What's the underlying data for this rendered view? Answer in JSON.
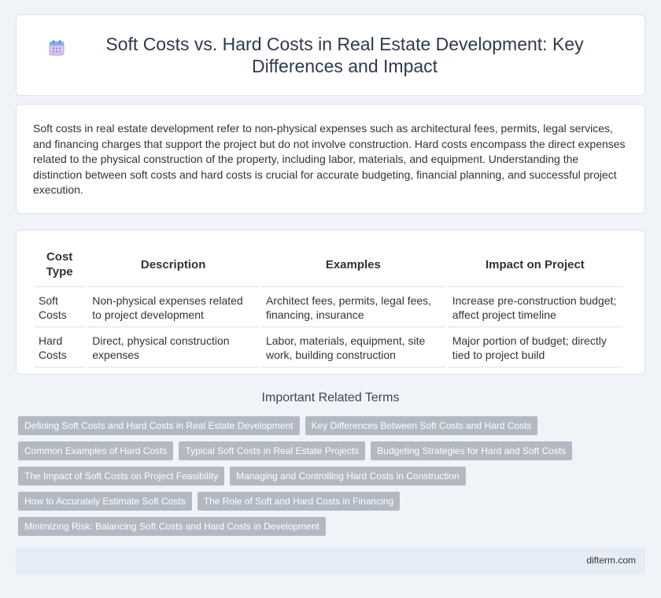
{
  "header": {
    "title": "Soft Costs vs. Hard Costs in Real Estate Development: Key Differences and Impact",
    "icon": "calendar-icon"
  },
  "intro": {
    "text": "Soft costs in real estate development refer to non-physical expenses such as architectural fees, permits, legal services, and financing charges that support the project but do not involve construction. Hard costs encompass the direct expenses related to the physical construction of the property, including labor, materials, and equipment. Understanding the distinction between soft costs and hard costs is crucial for accurate budgeting, financial planning, and successful project execution."
  },
  "table": {
    "headers": [
      "Cost Type",
      "Description",
      "Examples",
      "Impact on Project"
    ],
    "rows": [
      [
        "Soft Costs",
        "Non-physical expenses related to project development",
        "Architect fees, permits, legal fees, financing, insurance",
        "Increase pre-construction budget; affect project timeline"
      ],
      [
        "Hard Costs",
        "Direct, physical construction expenses",
        "Labor, materials, equipment, site work, building construction",
        "Major portion of budget; directly tied to project build"
      ]
    ]
  },
  "terms": {
    "title": "Important Related Terms",
    "items": [
      "Defining Soft Costs and Hard Costs in Real Estate Development",
      "Key Differences Between Soft Costs and Hard Costs",
      "Common Examples of Hard Costs",
      "Typical Soft Costs in Real Estate Projects",
      "Budgeting Strategies for Hard and Soft Costs",
      "The Impact of Soft Costs on Project Feasibility",
      "Managing and Controlling Hard Costs in Construction",
      "How to Accurately Estimate Soft Costs",
      "The Role of Soft and Hard Costs in Financing",
      "Minimizing Risk: Balancing Soft Costs and Hard Costs in Development"
    ]
  },
  "footer": {
    "site": "difterm.com"
  },
  "colors": {
    "background": "#f0f3f8",
    "tag": "#b3b9c3",
    "footer": "#e6ecf6"
  }
}
